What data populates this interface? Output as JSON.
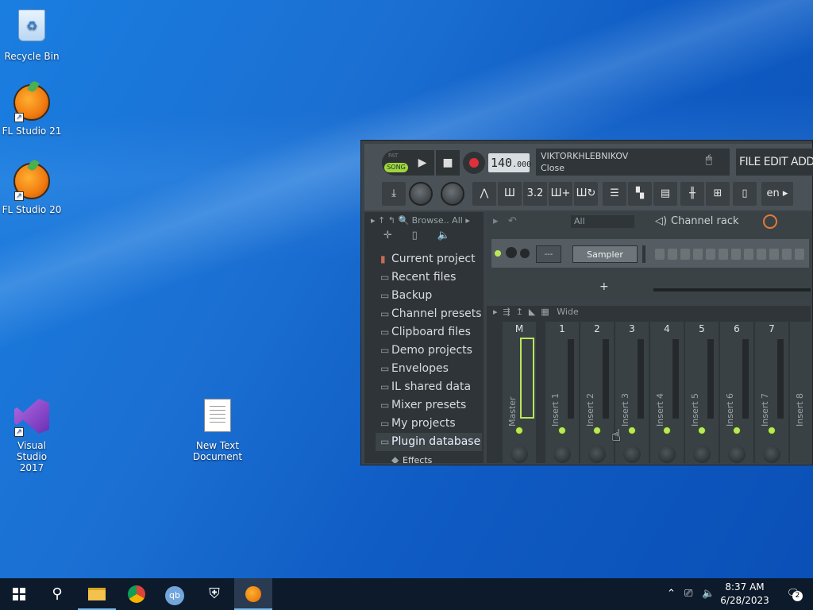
{
  "desktop": {
    "icons": [
      {
        "label": "Recycle Bin"
      },
      {
        "label": "FL Studio 21"
      },
      {
        "label": "FL Studio 20"
      },
      {
        "label": "Visual Studio 2017"
      },
      {
        "label": "New Text Document"
      }
    ]
  },
  "fl": {
    "transport": {
      "pat_label": "PAT",
      "song_label": "SONG",
      "tempo_main": "140",
      "tempo_frac": ".000"
    },
    "hint": {
      "line1": "VIKTORKHLEBNIKOV",
      "line2": "Close"
    },
    "menu": "FILE  EDIT  ADD  PA",
    "language": "en",
    "browser": {
      "filter": "Browse..  All",
      "items": [
        "Current project",
        "Recent files",
        "Backup",
        "Channel presets",
        "Clipboard files",
        "Demo projects",
        "Envelopes",
        "IL shared data",
        "Mixer presets",
        "My projects",
        "Plugin database",
        "Effects"
      ]
    },
    "channel_rack": {
      "filter": "All",
      "title": "Channel rack",
      "dash": "---",
      "channel_name": "Sampler",
      "add": "+"
    },
    "mixer": {
      "view": "Wide",
      "strips": [
        {
          "num": "M",
          "label": "Master"
        },
        {
          "num": "1",
          "label": "Insert 1"
        },
        {
          "num": "2",
          "label": "Insert 2"
        },
        {
          "num": "3",
          "label": "Insert 3"
        },
        {
          "num": "4",
          "label": "Insert 4"
        },
        {
          "num": "5",
          "label": "Insert 5"
        },
        {
          "num": "6",
          "label": "Insert 6"
        },
        {
          "num": "7",
          "label": "Insert 7"
        },
        {
          "num": "",
          "label": "Insert 8"
        }
      ]
    }
  },
  "taskbar": {
    "time": "8:37 AM",
    "date": "6/28/2023",
    "notifications": "2"
  }
}
